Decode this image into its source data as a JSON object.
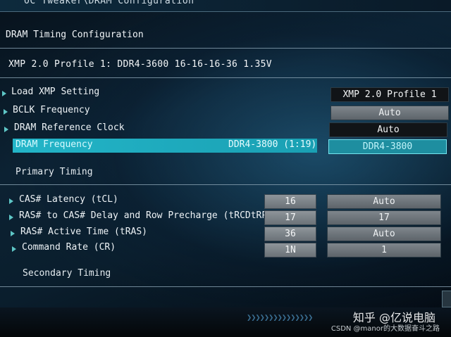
{
  "breadcrumb": "OC Tweaker\\DRAM Configuration",
  "section_title": "DRAM Timing Configuration",
  "xmp_info": "XMP 2.0 Profile 1: DDR4-3600 16-16-16-36 1.35V",
  "settings": [
    {
      "label": "Load XMP Setting",
      "value": "XMP 2.0 Profile 1"
    },
    {
      "label": "BCLK Frequency",
      "value": "Auto"
    },
    {
      "label": "DRAM Reference Clock",
      "value": "Auto"
    },
    {
      "label": "DRAM Frequency",
      "current": "DDR4-3800 (1:19)",
      "value": "DDR4-3800"
    }
  ],
  "primary_timing": {
    "heading": "Primary Timing",
    "rows": [
      {
        "label": "CAS# Latency (tCL)",
        "current": "16",
        "value": "Auto"
      },
      {
        "label": "RAS# to CAS# Delay and Row Precharge (tRCDtRP)",
        "current": "17",
        "value": "17"
      },
      {
        "label": "RAS# Active Time (tRAS)",
        "current": "36",
        "value": "Auto"
      },
      {
        "label": "Command Rate (CR)",
        "current": "1N",
        "value": "1"
      }
    ]
  },
  "secondary_timing": {
    "heading": "Secondary Timing"
  },
  "watermark": {
    "main": "知乎 @亿说电脑",
    "sub": "CSDN @manor的大数据奋斗之路"
  }
}
